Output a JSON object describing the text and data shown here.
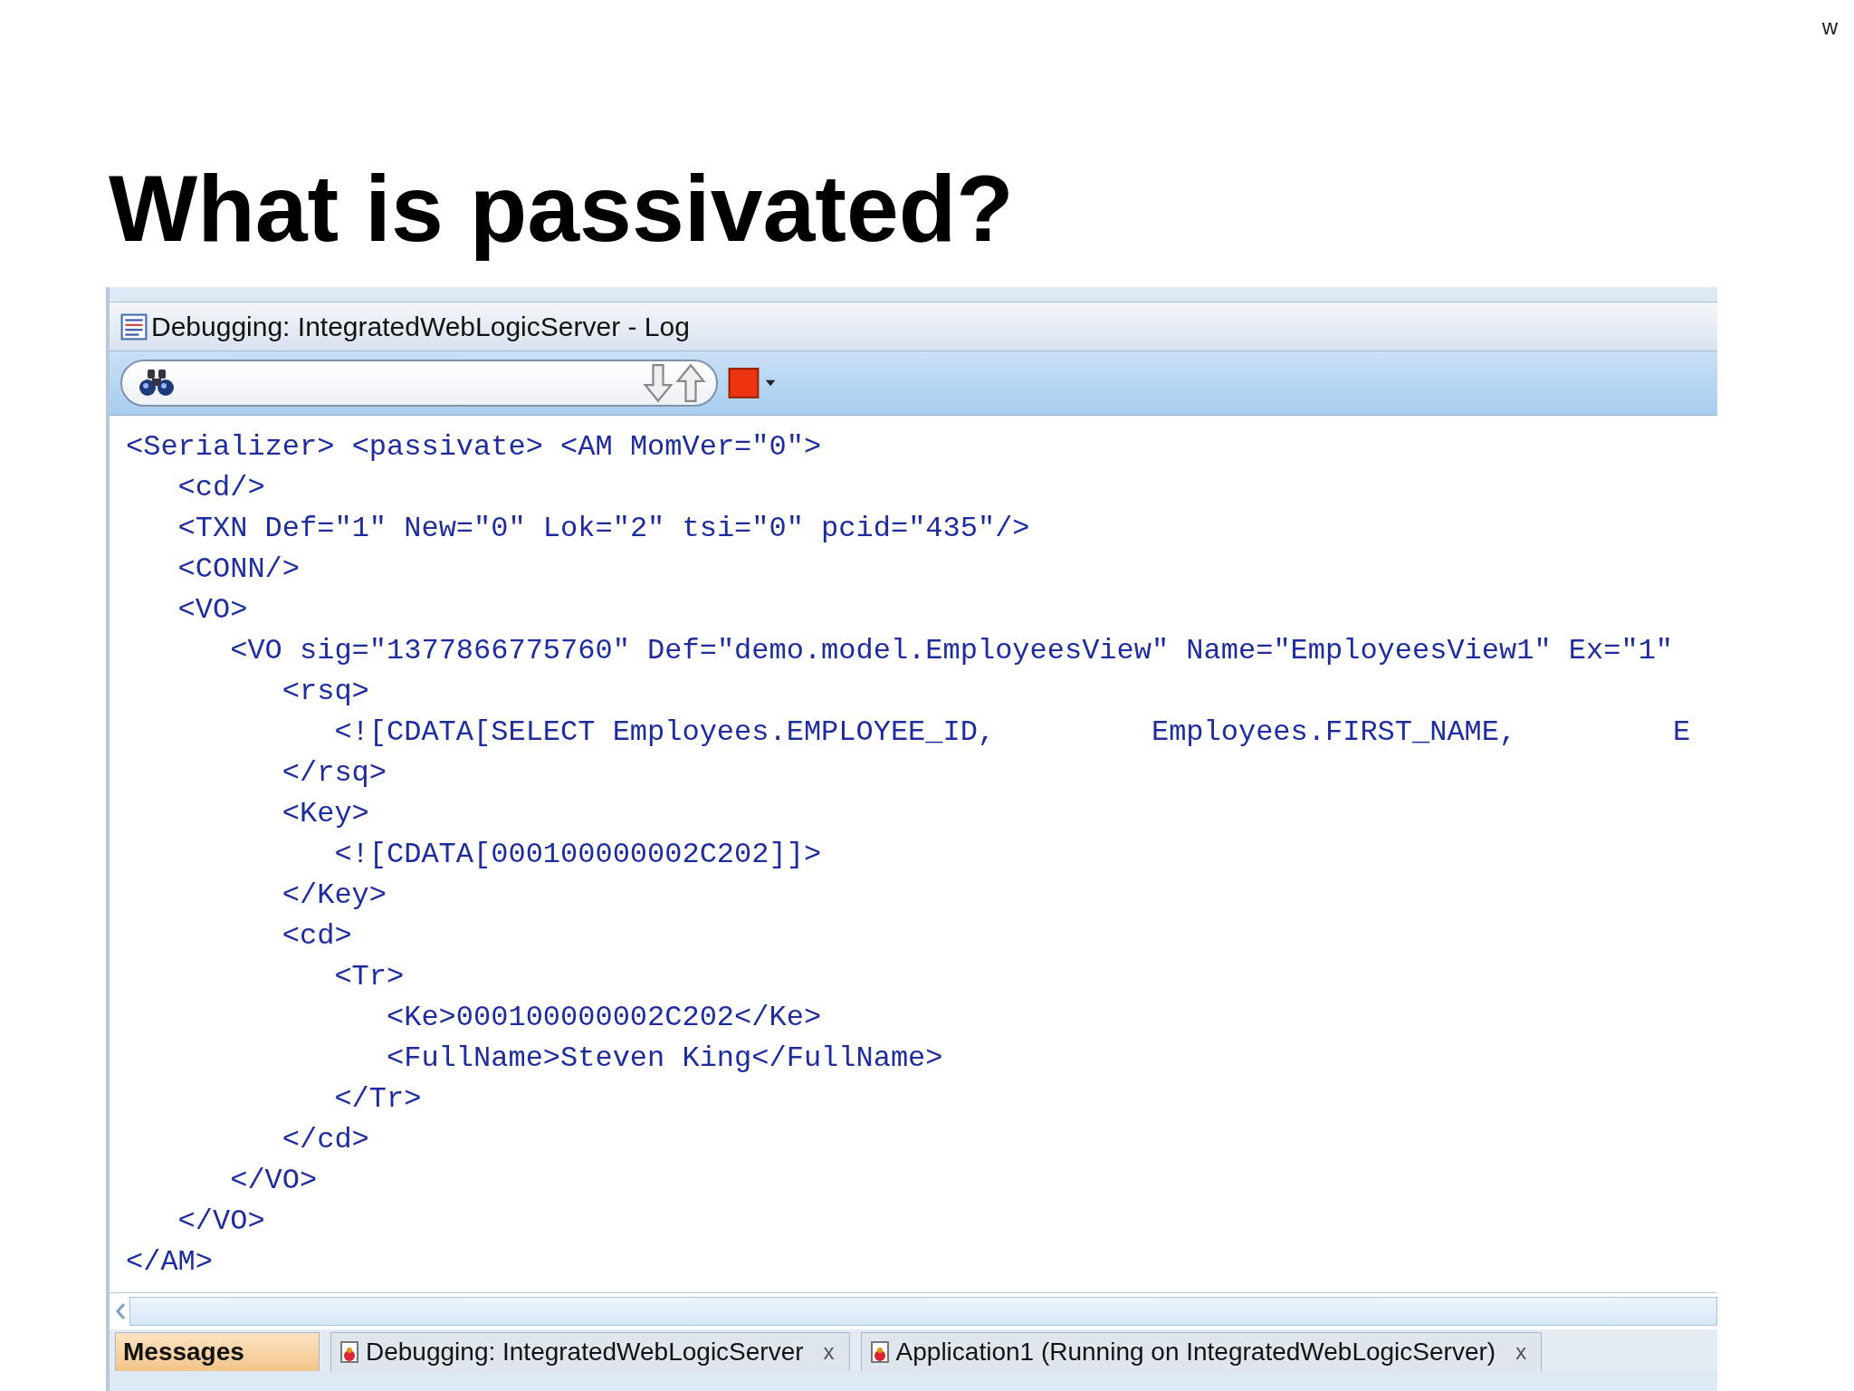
{
  "corner_mark": "w",
  "title": "What is passivated?",
  "window": {
    "title": "Debugging: IntegratedWebLogicServer - Log"
  },
  "log_lines": [
    {
      "text": "<Serializer> <passivate> <AM MomVer=\"0\">",
      "children": [
        {
          "text": "<cd/>"
        },
        {
          "text": "<TXN Def=\"1\" New=\"0\" Lok=\"2\" tsi=\"0\" pcid=\"435\"/>"
        },
        {
          "text": "<CONN/>"
        },
        {
          "text": "<VO>",
          "children": [
            {
              "text": "<VO sig=\"1377866775760\" Def=\"demo.model.EmployeesView\" Name=\"EmployeesView1\" Ex=\"1\"",
              "children": [
                {
                  "text": "<rsq>",
                  "children": [
                    {
                      "text": "<![CDATA[SELECT Employees.EMPLOYEE_ID,         Employees.FIRST_NAME,         E"
                    }
                  ]
                },
                {
                  "text": "</rsq>"
                },
                {
                  "text": "<Key>",
                  "children": [
                    {
                      "text": "<![CDATA[000100000002C202]]>"
                    }
                  ]
                },
                {
                  "text": "</Key>"
                },
                {
                  "text": "<cd>",
                  "children": [
                    {
                      "text": "<Tr>",
                      "children": [
                        {
                          "text": "<Ke>000100000002C202</Ke>"
                        },
                        {
                          "text": "<FullName>Steven King</FullName>"
                        }
                      ]
                    },
                    {
                      "text": "</Tr>"
                    }
                  ]
                },
                {
                  "text": "</cd>"
                }
              ]
            },
            {
              "text": "</VO>"
            }
          ]
        },
        {
          "text": "</VO>"
        }
      ]
    },
    {
      "text": "</AM>"
    }
  ],
  "tabs": [
    {
      "label": "Messages",
      "selected": true
    },
    {
      "label": "Debugging: IntegratedWebLogicServer",
      "selected": false,
      "close": "x"
    },
    {
      "label": "Application1 (Running on IntegratedWebLogicServer)",
      "selected": false,
      "close": "x"
    }
  ]
}
